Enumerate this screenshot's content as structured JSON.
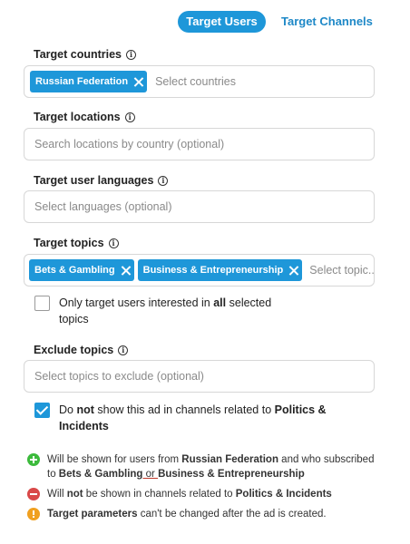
{
  "tabs": {
    "active": "Target Users",
    "inactive": "Target Channels"
  },
  "countries": {
    "label": "Target countries",
    "chips": [
      "Russian Federation"
    ],
    "placeholder": "Select countries"
  },
  "locations": {
    "label": "Target locations",
    "placeholder": "Search locations by country (optional)"
  },
  "languages": {
    "label": "Target user languages",
    "placeholder": "Select languages (optional)"
  },
  "topics": {
    "label": "Target topics",
    "chips": [
      "Bets & Gambling",
      "Business & Entrepreneurship"
    ],
    "placeholder": "Select topic..."
  },
  "only_interested": {
    "pre": "Only target users interested in ",
    "bold": "all",
    "post": " selected",
    "line2": "topics",
    "checked": false
  },
  "exclude": {
    "label": "Exclude topics",
    "placeholder": "Select topics to exclude (optional)"
  },
  "politics": {
    "pre": "Do ",
    "bold1": "not",
    "mid": " show this ad in channels related to ",
    "bold2": "Politics &",
    "bold3": "Incidents",
    "checked": true
  },
  "notes": {
    "n1_pre": "Will be shown for users from ",
    "n1_country": "Russian Federation",
    "n1_mid": " and who subscribed",
    "n1_line2_pre": "to ",
    "n1_topic1": "Bets & Gambling",
    "n1_or": " or ",
    "n1_topic2": "Business & Entrepreneurship",
    "n2_pre": "Will ",
    "n2_bold": "not",
    "n2_mid": " be shown in channels related to ",
    "n2_topic": "Politics & Incidents",
    "n3_bold": "Target parameters",
    "n3_post": " can't be changed after the ad is created."
  },
  "info_icon_glyph": "i",
  "colors": {
    "accent": "#1e97d9",
    "green": "#3cba3c",
    "red": "#d94848",
    "orange": "#f0a020"
  }
}
